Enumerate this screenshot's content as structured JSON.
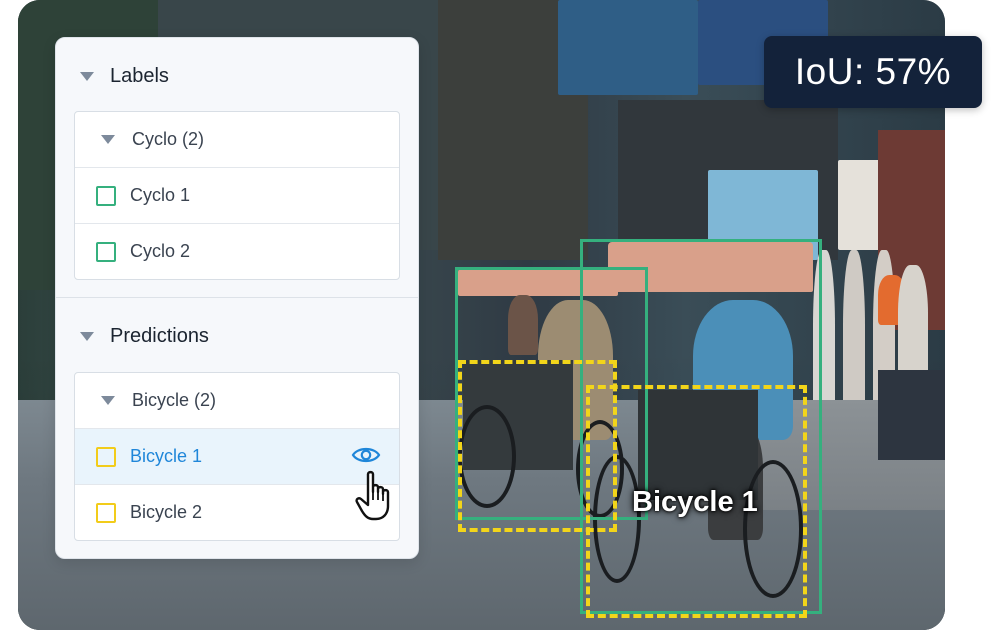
{
  "panel": {
    "labels_title": "Labels",
    "labels_group": {
      "header": "Cyclo (2)",
      "items": [
        "Cyclo 1",
        "Cyclo 2"
      ]
    },
    "predictions_title": "Predictions",
    "predictions_group": {
      "header": "Bicycle (2)",
      "items": [
        "Bicycle 1",
        "Bicycle 2"
      ],
      "selected": "Bicycle 1"
    }
  },
  "overlay": {
    "iou_text": "IoU: 57%",
    "prediction_label": "Bicycle 1"
  },
  "colors": {
    "ground_truth": "#35b07e",
    "prediction": "#f2d51a",
    "selected_text": "#1f86d9",
    "badge_bg": "#13223a"
  },
  "icons": [
    "caret-down-icon",
    "checkbox-icon",
    "eye-icon",
    "hand-pointer-icon"
  ]
}
